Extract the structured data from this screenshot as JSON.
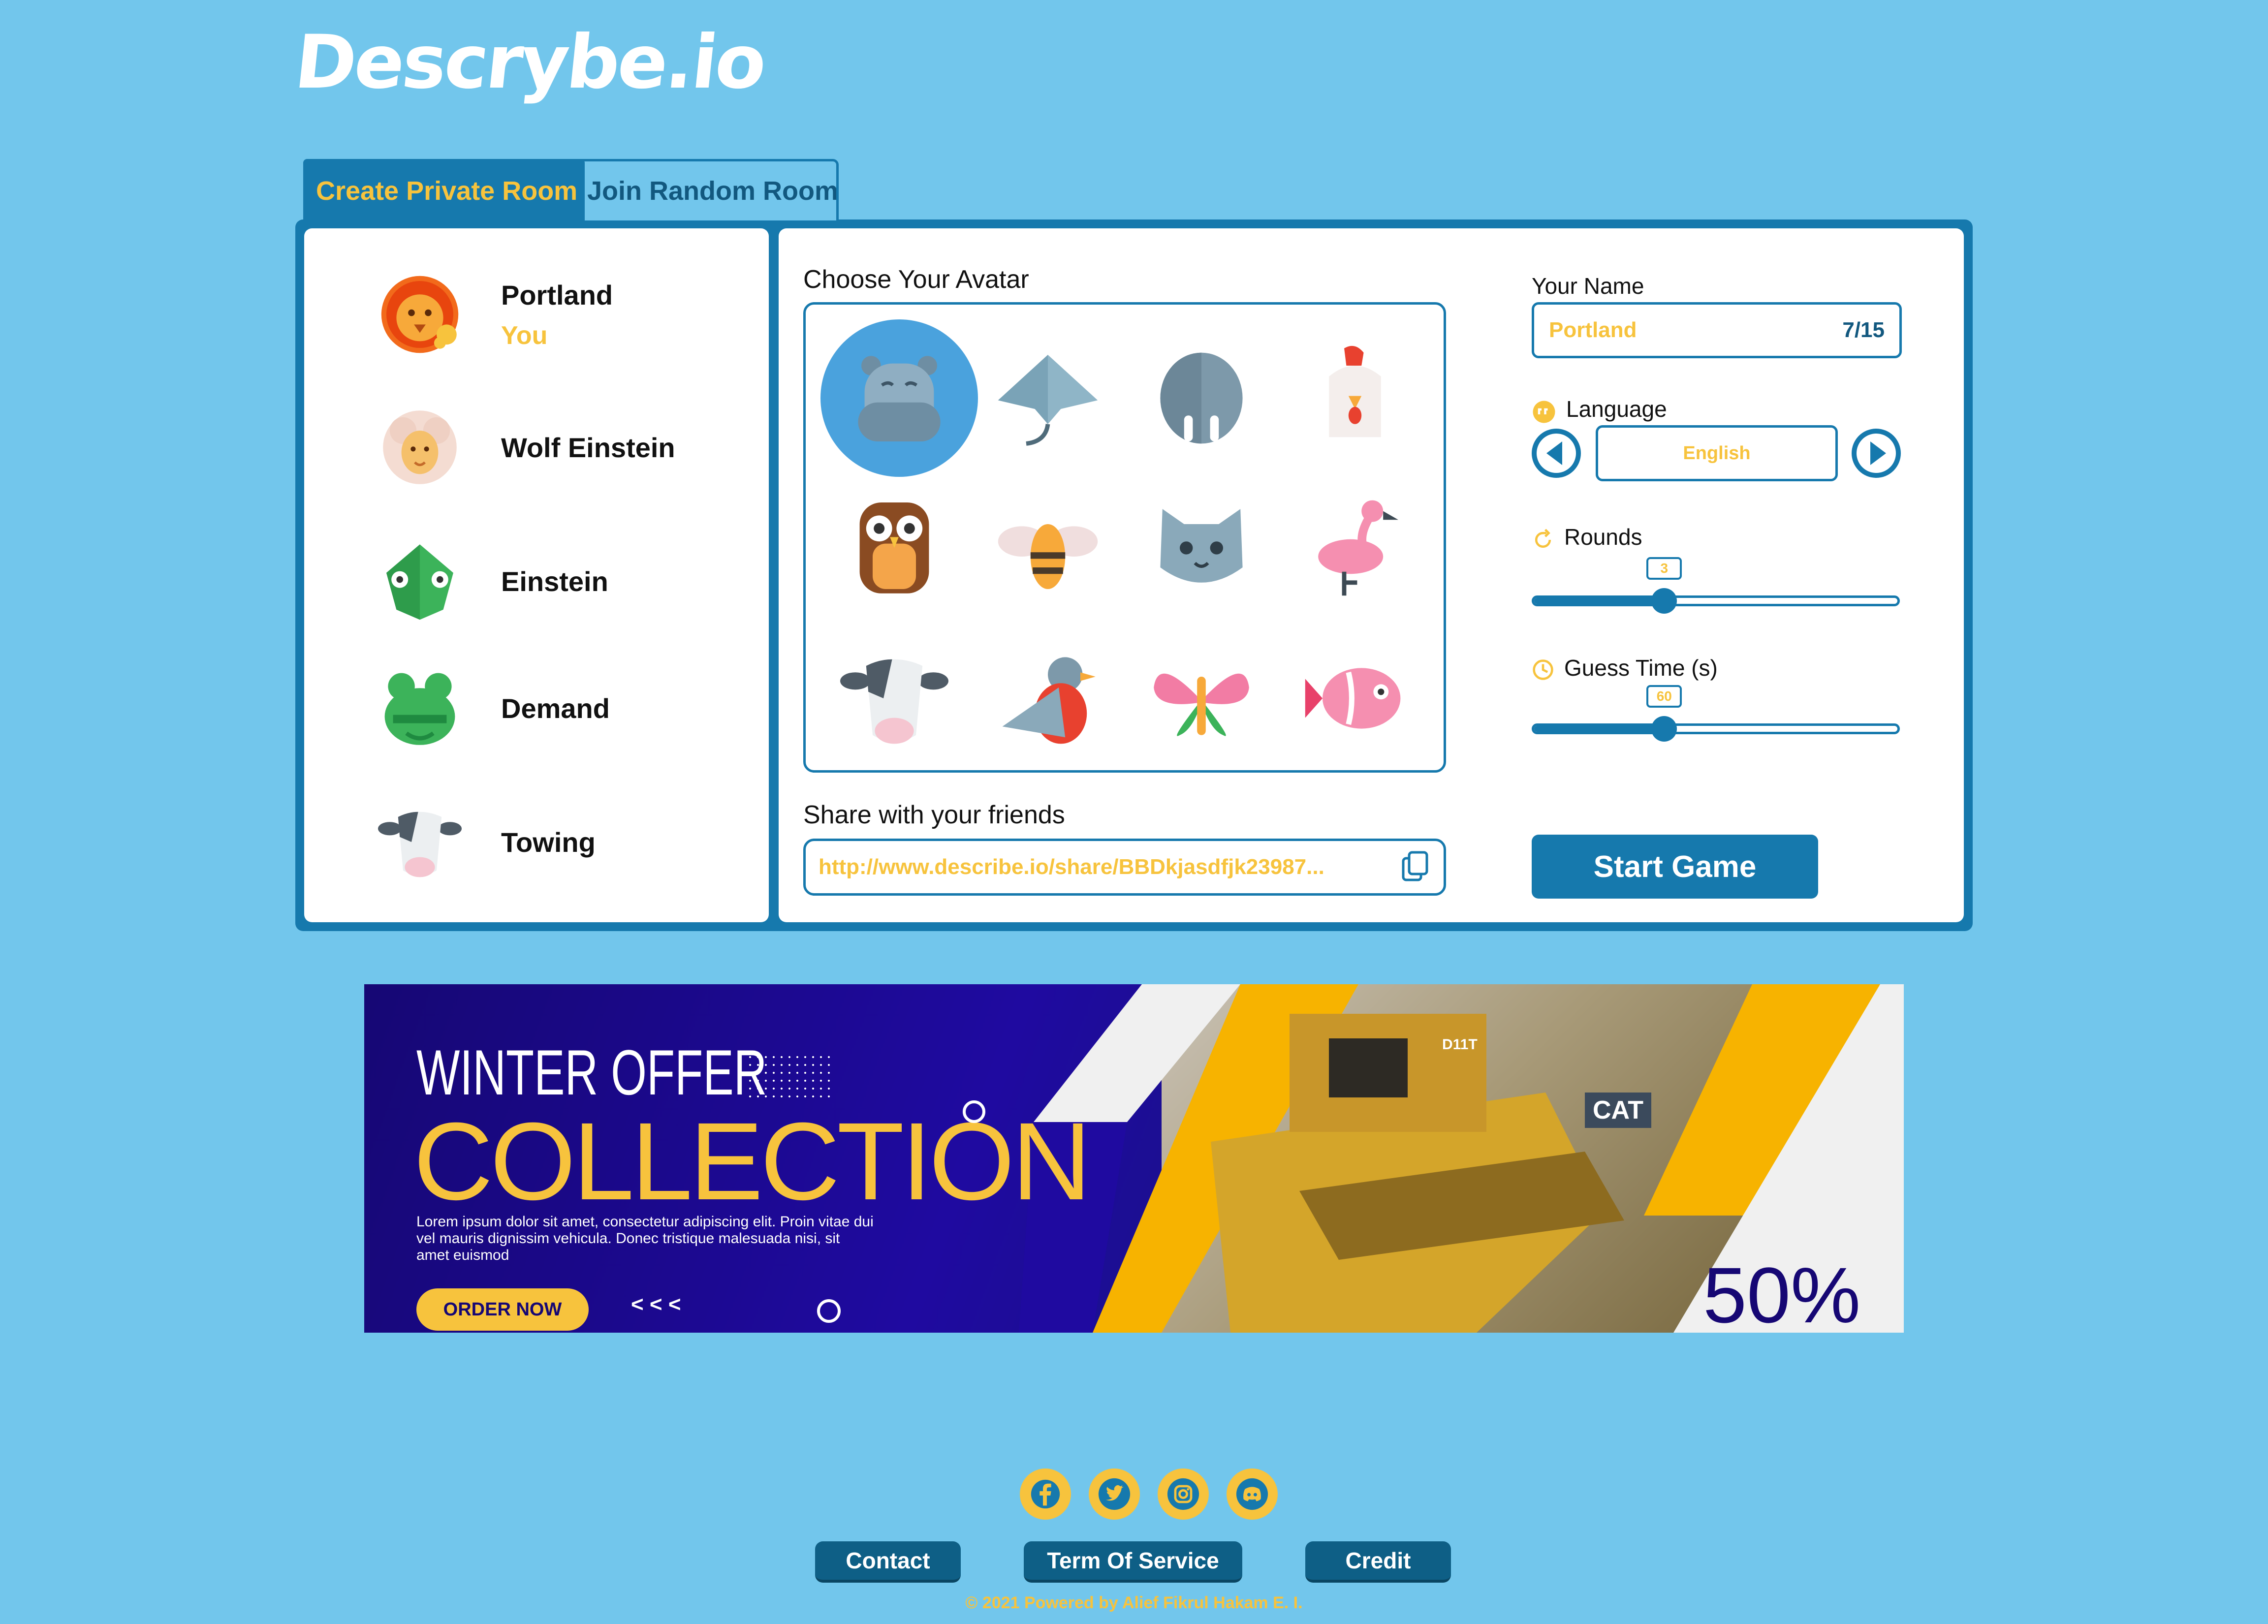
{
  "app": {
    "logo": "Descrybe.io"
  },
  "tabs": [
    {
      "label": "Create Private Room",
      "active": true
    },
    {
      "label": "Join Random Room",
      "active": false
    }
  ],
  "players": [
    {
      "name": "Portland",
      "tag": "You",
      "avatar": "lion-icon"
    },
    {
      "name": "Wolf Einstein",
      "tag": "",
      "avatar": "sheep-icon"
    },
    {
      "name": "Einstein",
      "tag": "",
      "avatar": "chameleon-icon"
    },
    {
      "name": "Demand",
      "tag": "",
      "avatar": "frog-icon"
    },
    {
      "name": "Towing",
      "tag": "",
      "avatar": "cow-icon"
    }
  ],
  "avatar_picker": {
    "label": "Choose Your Avatar",
    "avatars": [
      "hippo-icon",
      "stingray-icon",
      "walrus-icon",
      "chicken-icon",
      "owl-icon",
      "bee-icon",
      "cat-icon",
      "flamingo-icon",
      "cow-icon",
      "pigeon-icon",
      "butterfly-icon",
      "fish-icon"
    ],
    "selected_index": 0
  },
  "share": {
    "label": "Share with your friends",
    "url": "http://www.describe.io/share/BBDkjasdfjk23987..."
  },
  "settings": {
    "name_label": "Your Name",
    "name_value": "Portland",
    "name_count": "7/15",
    "language_label": "Language",
    "language_value": "English",
    "rounds_label": "Rounds",
    "rounds_value": "3",
    "rounds_fraction": 0.36,
    "guess_time_label": "Guess Time (s)",
    "guess_time_value": "60",
    "guess_time_fraction": 0.36,
    "start_label": "Start Game"
  },
  "ad": {
    "line1": "WINTER OFFER",
    "line2": "COLLECTION",
    "body": "Lorem ipsum dolor sit amet, consectetur adipiscing elit. Proin vitae dui vel mauris dignissim vehicula. Donec tristique malesuada nisi, sit amet euismod",
    "cta": "ORDER NOW",
    "arrows": "< < <",
    "discount": "50%",
    "brand_badge": "CAT",
    "model_badge": "D11T"
  },
  "footer": {
    "social": [
      "facebook-icon",
      "twitter-icon",
      "instagram-icon",
      "discord-icon"
    ],
    "links": [
      "Contact",
      "Term Of Service",
      "Credit"
    ],
    "copyright": "© 2021 Powered by Alief Fikrul Hakam E. I."
  },
  "colors": {
    "background": "#72c6ec",
    "primary": "#1679ad",
    "accent": "#f7c33d",
    "dark": "#0e5f86"
  }
}
